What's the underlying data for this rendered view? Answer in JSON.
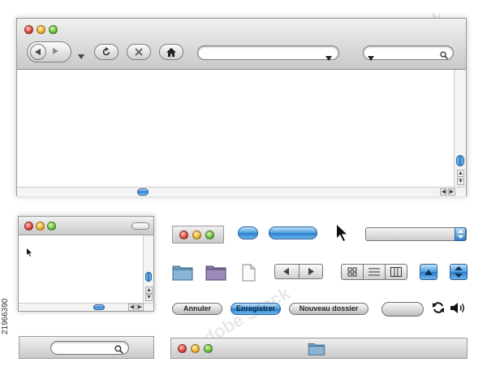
{
  "watermark": "Adobe Stock",
  "stock_id": "21966390",
  "buttons": {
    "cancel": "Annuler",
    "save": "Enregistrer",
    "new_folder": "Nouveau dossier"
  },
  "icons": {
    "back": "back-arrow-icon",
    "forward": "forward-arrow-icon",
    "reload": "reload-icon",
    "stop": "stop-icon",
    "home": "home-icon",
    "search": "search-icon",
    "cursor": "mouse-pointer-icon",
    "sync": "sync-icon",
    "volume": "speaker-icon"
  },
  "colors": {
    "accent_blue": "#2c7ccc",
    "close_red": "#e0463a",
    "minimize_yellow": "#f2b32e",
    "zoom_green": "#6cc13a",
    "folder_blue": "#6f9fc4",
    "folder_purple": "#8a78a8"
  }
}
